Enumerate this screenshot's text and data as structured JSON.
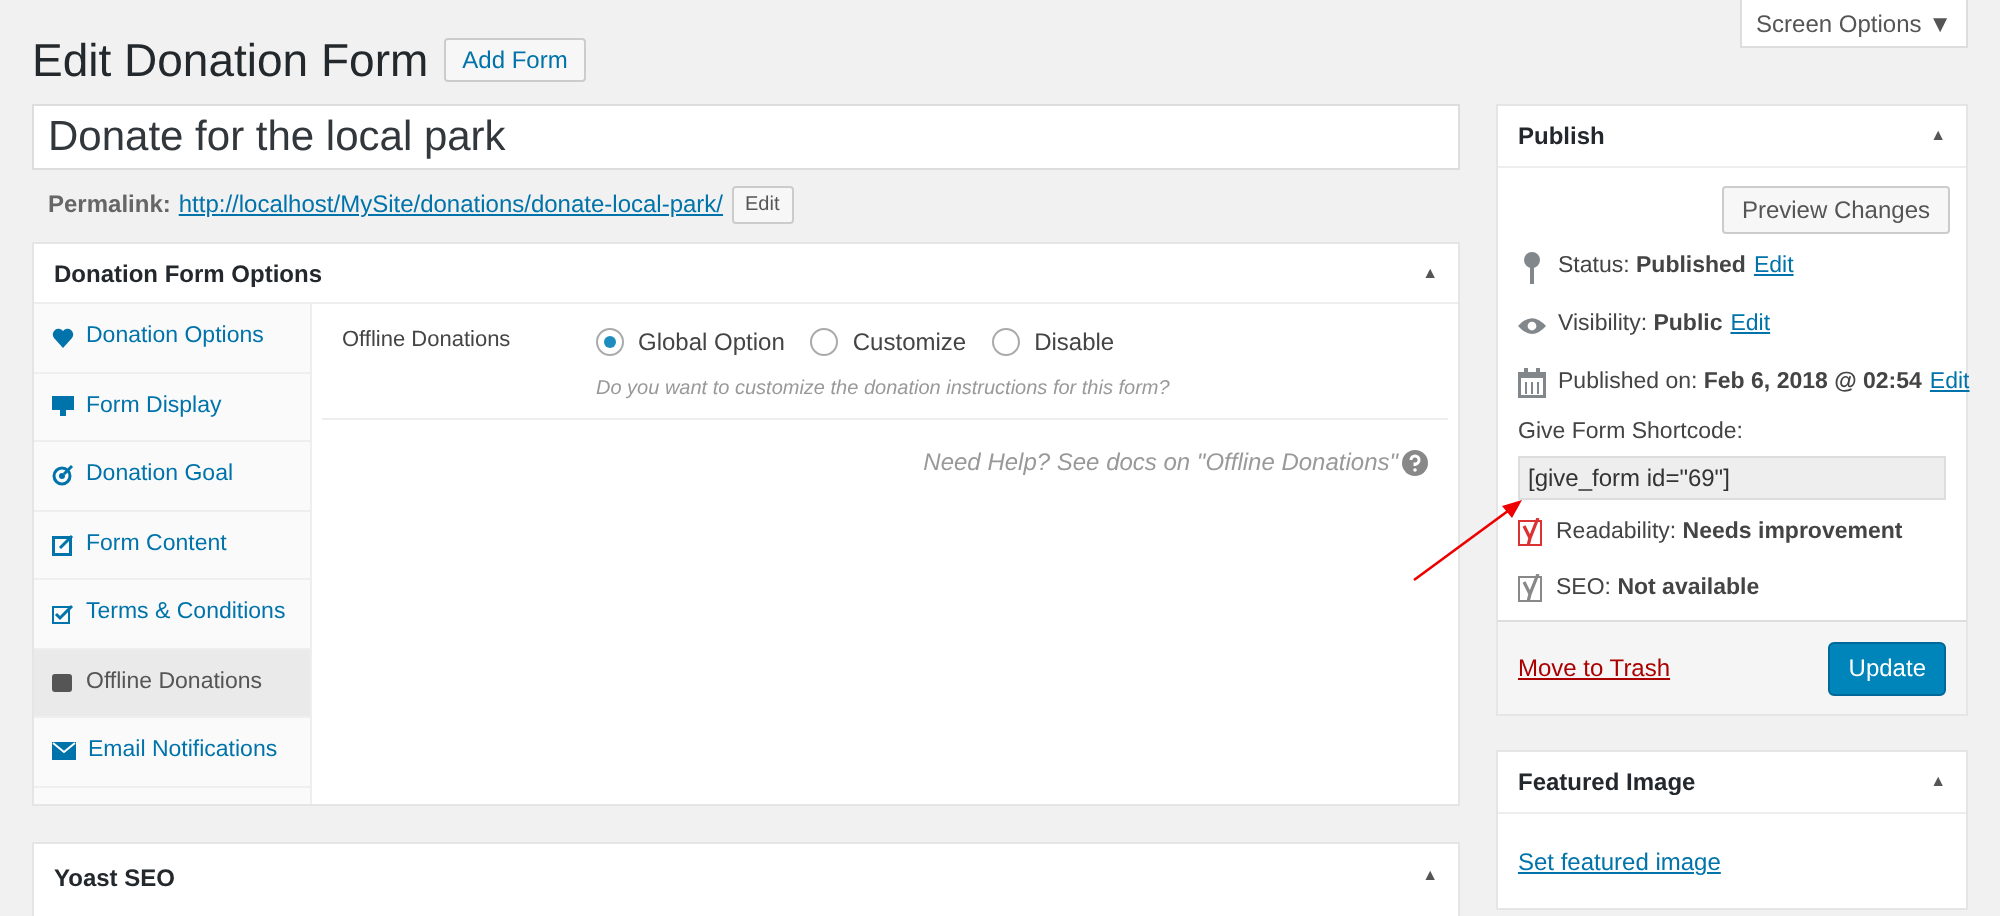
{
  "screen_options": "Screen Options ▼",
  "page_title": "Edit Donation Form",
  "add_button": "Add Form",
  "title_field": "Donate for the local park",
  "permalink": {
    "label": "Permalink:",
    "url": "http://localhost/MySite/donations/donate-local-park/",
    "edit": "Edit"
  },
  "options_box": {
    "title": "Donation Form Options",
    "toggle": "▲",
    "tabs": [
      {
        "kind": "heart",
        "label": "Donation Options",
        "selected": false
      },
      {
        "kind": "monitor",
        "label": "Form Display",
        "selected": false
      },
      {
        "kind": "target",
        "label": "Donation Goal",
        "selected": false
      },
      {
        "kind": "edit",
        "label": "Form Content",
        "selected": false
      },
      {
        "kind": "check",
        "label": "Terms & Conditions",
        "selected": false
      },
      {
        "kind": "wallet",
        "label": "Offline Donations",
        "selected": true
      },
      {
        "kind": "mail",
        "label": "Email Notifications",
        "selected": false
      }
    ],
    "field_label": "Offline Donations",
    "radios": [
      {
        "label": "Global Option",
        "selected": true
      },
      {
        "label": "Customize",
        "selected": false
      },
      {
        "label": "Disable",
        "selected": false
      }
    ],
    "description": "Do you want to customize the donation instructions for this form?",
    "help": "Need Help? See docs on \"Offline Donations\""
  },
  "yoast_box": {
    "title": "Yoast SEO",
    "toggle": "▲"
  },
  "publish": {
    "title": "Publish",
    "toggle": "▲",
    "preview": "Preview Changes",
    "rows": [
      {
        "kind": "pin",
        "label": "Status:",
        "value": "Published",
        "edit": "Edit"
      },
      {
        "kind": "eye",
        "label": "Visibility:",
        "value": "Public",
        "edit": "Edit"
      },
      {
        "kind": "calendar",
        "label": "Published on:",
        "value": "Feb 6, 2018 @ 02:54",
        "edit": "Edit"
      }
    ],
    "shortcode_label": "Give Form Shortcode:",
    "shortcode": "[give_form id=\"69\"]",
    "scores": [
      {
        "label": "Readability:",
        "value": "Needs improvement",
        "color": "#dc3232"
      },
      {
        "label": "SEO:",
        "value": "Not available",
        "color": "#888888"
      }
    ],
    "trash": "Move to Trash",
    "update": "Update"
  },
  "featured": {
    "title": "Featured Image",
    "toggle": "▲",
    "link": "Set featured image"
  }
}
